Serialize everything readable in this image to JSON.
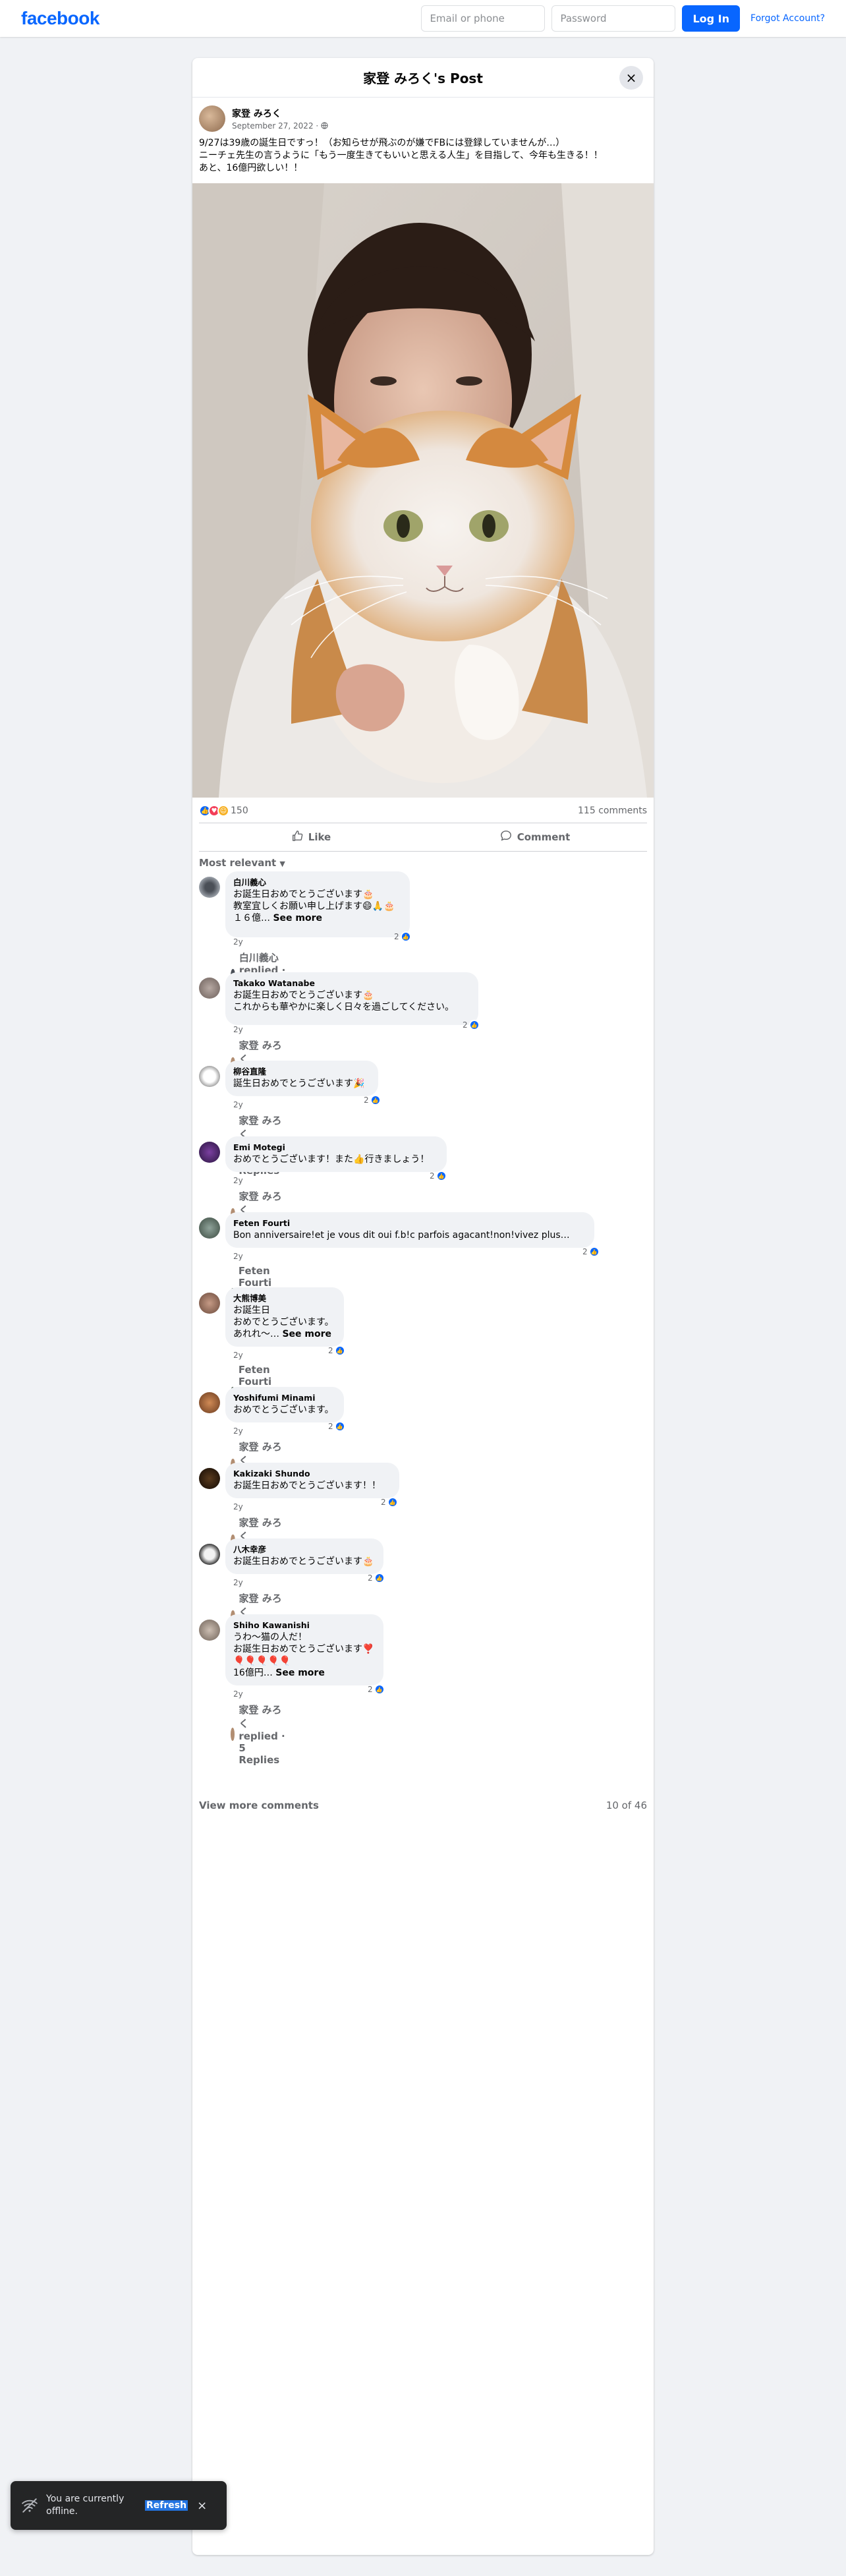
{
  "topbar": {
    "logo": "facebook",
    "email_placeholder": "Email or phone",
    "password_placeholder": "Password",
    "login_label": "Log In",
    "forgot_label": "Forgot Account?"
  },
  "post": {
    "title": "家登 みろく's Post",
    "close_icon": "×",
    "author": "家登 みろく",
    "date": "September 27, 2022 · ",
    "text": "9/27は39歳の誕生日ですっ！（お知らせが飛ぶのが嫌でFBには登録していませんが…）\nニーチェ先生の言うように「もう一度生きてもいいと思える人生」を目指して、今年も生きる！！\nあと、16億円欲しい！！",
    "reactions_count": "150",
    "comments_count": "115 comments",
    "like_label": "Like",
    "comment_label": "Comment",
    "sort_label": "Most relevant"
  },
  "comments": [
    {
      "name": "白川義心",
      "text": "お誕生日おめでとうございます🎂\n教室宜しくお願い申し上げます😄🙏🎂\n１６億… ",
      "see_more": "See more",
      "time": "2y",
      "likes": "2",
      "replies": "白川義心 replied · 2 Replies"
    },
    {
      "name": "Takako Watanabe",
      "text": "お誕生日おめでとうございます🎂\nこれからも華やかに楽しく日々を過ごしてください。",
      "see_more": "",
      "time": "2y",
      "likes": "2",
      "replies": "家登 みろく replied · 1 Reply"
    },
    {
      "name": "柳谷直隆",
      "text": "誕生日おめでとうございます🎉",
      "see_more": "",
      "time": "2y",
      "likes": "2",
      "replies": "家登 みろく replied · 3 Replies"
    },
    {
      "name": "Emi Motegi",
      "text": "おめでとうございます！また👍行きましょう！",
      "see_more": "",
      "time": "2y",
      "likes": "2",
      "replies": "家登 みろく replied · 1 Reply"
    },
    {
      "name": "Feten Fourti",
      "text": "Bon anniversaire!et je vous dit oui f.b!c parfois agacant!non!vivez plus…",
      "see_more": "",
      "time": "2y",
      "likes": "2",
      "replies": "Feten Fourti replied · 3 Replies"
    },
    {
      "name": "大熊博美",
      "text": "お誕生日\nおめでとうございます。\nあれれ〜… ",
      "see_more": "See more",
      "time": "2y",
      "likes": "2",
      "replies": "Feten Fourti replied · 3 Replies"
    },
    {
      "name": "Yoshifumi Minami",
      "text": "おめでとうございます。",
      "see_more": "",
      "time": "2y",
      "likes": "2",
      "replies": "家登 みろく replied · 1 Reply"
    },
    {
      "name": "Kakizaki Shundo",
      "text": "お誕生日おめでとうございます！！",
      "see_more": "",
      "time": "2y",
      "likes": "2",
      "replies": "家登 みろく replied · 1 Reply"
    },
    {
      "name": "八木幸彦",
      "text": "お誕生日おめでとうございます🎂",
      "see_more": "",
      "time": "2y",
      "likes": "2",
      "replies": "家登 みろく replied · 1 Reply"
    },
    {
      "name": "Shiho Kawanishi",
      "text": "うわ〜猫の人だ！\nお誕生日おめでとうございます❣️\n🎈🎈🎈🎈🎈\n16億円… ",
      "see_more": "See more",
      "time": "2y",
      "likes": "2",
      "replies": "家登 みろく replied · 5 Replies"
    }
  ],
  "footer": {
    "view_more": "View more comments",
    "count": "10 of 46"
  },
  "toast": {
    "text": "You are currently offline.",
    "refresh": "Refresh",
    "close": "×"
  }
}
